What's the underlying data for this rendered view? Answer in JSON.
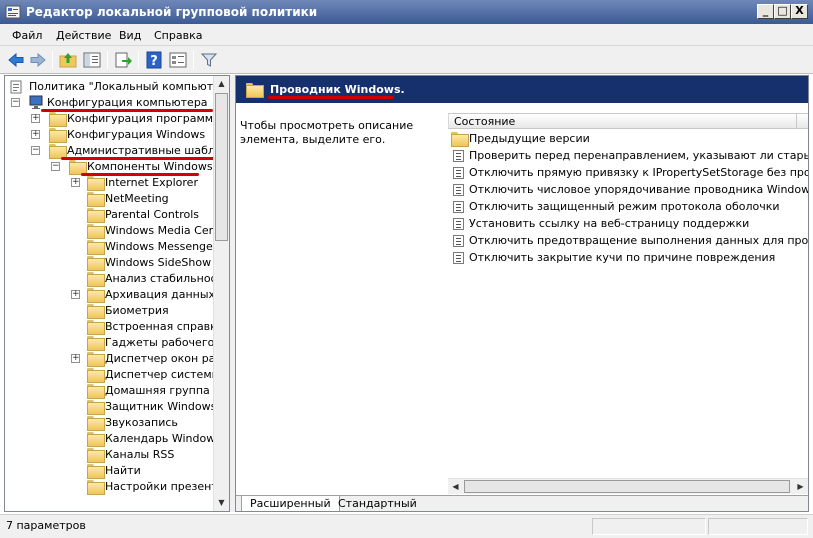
{
  "window": {
    "title": "Редактор локальной групповой политики",
    "buttons": [
      "_",
      "□",
      "X"
    ]
  },
  "menu": [
    "Файл",
    "Действие",
    "Вид",
    "Справка"
  ],
  "toolbar": [
    "back-icon",
    "forward-icon",
    "up-folder-icon",
    "show-tree-icon",
    "export-icon",
    "help-icon",
    "properties-icon",
    "filter-icon"
  ],
  "tree": {
    "root": "Политика \"Локальный компьютер\"",
    "computer_config": "Конфигурация компьютера",
    "software_config": "Конфигурация программ",
    "windows_config": "Конфигурация Windows",
    "admin_templates": "Административные шаблоны",
    "windows_components": "Компоненты Windows",
    "children": [
      "Internet Explorer",
      "NetMeeting",
      "Parental Controls",
      "Windows Media Center",
      "Windows Messenger",
      "Windows SideShow",
      "Анализ стабильности",
      "Архивация данных",
      "Биометрия",
      "Встроенная справка",
      "Гаджеты рабочего стола",
      "Диспетчер окон рабочего стола",
      "Диспетчер системных",
      "Домашняя группа",
      "Защитник Windows",
      "Звукозапись",
      "Календарь Windows",
      "Каналы RSS",
      "Найти",
      "Настройки презентации"
    ]
  },
  "right": {
    "header": "Проводник Windows.",
    "description": "Чтобы просмотреть описание элемента, выделите его.",
    "column": "Состояние",
    "items": [
      "Предыдущие версии",
      "Проверить перед перенаправлением, указывают ли старый ...",
      "Отключить прямую привязку к IPropertySetStorage без пром...",
      "Отключить числовое упорядочивание проводника Windows",
      "Отключить защищенный режим протокола оболочки",
      "Установить ссылку на веб-страницу поддержки",
      "Отключить предотвращение выполнения данных для прово...",
      "Отключить закрытие кучи по причине повреждения"
    ],
    "tabs": [
      "Расширенный",
      "Стандартный"
    ]
  },
  "status": "7 параметров",
  "colors": {
    "title": "#3b5a94",
    "header": "#16306e",
    "highlight": "#d10000"
  }
}
